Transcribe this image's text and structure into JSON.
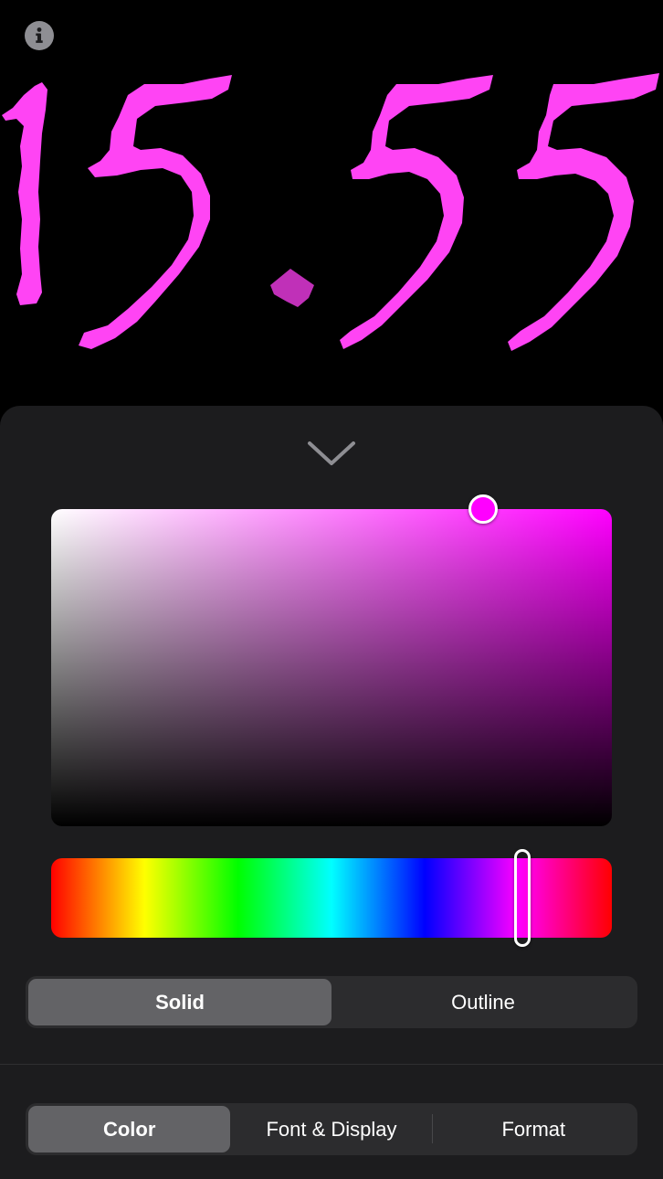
{
  "clock": {
    "time_text": "15.55",
    "color": "#ff44f4",
    "dot_color": "#c030b8"
  },
  "info": {
    "icon": "info-icon"
  },
  "panel": {
    "collapse_icon": "chevron-down-icon",
    "picker": {
      "selected_color": "#ff00ff",
      "hue_degrees": 305,
      "hue_position_fraction": 0.84,
      "saturation_fraction": 0.77,
      "brightness_fraction": 1.0
    },
    "style_options": [
      "Solid",
      "Outline"
    ],
    "style_selected": "Solid",
    "tabs": [
      "Color",
      "Font & Display",
      "Format"
    ],
    "tab_selected": "Color"
  },
  "colors": {
    "background": "#000000",
    "panel": "#1c1c1e",
    "segment_track": "#2c2c2e",
    "segment_selected": "#636366"
  }
}
